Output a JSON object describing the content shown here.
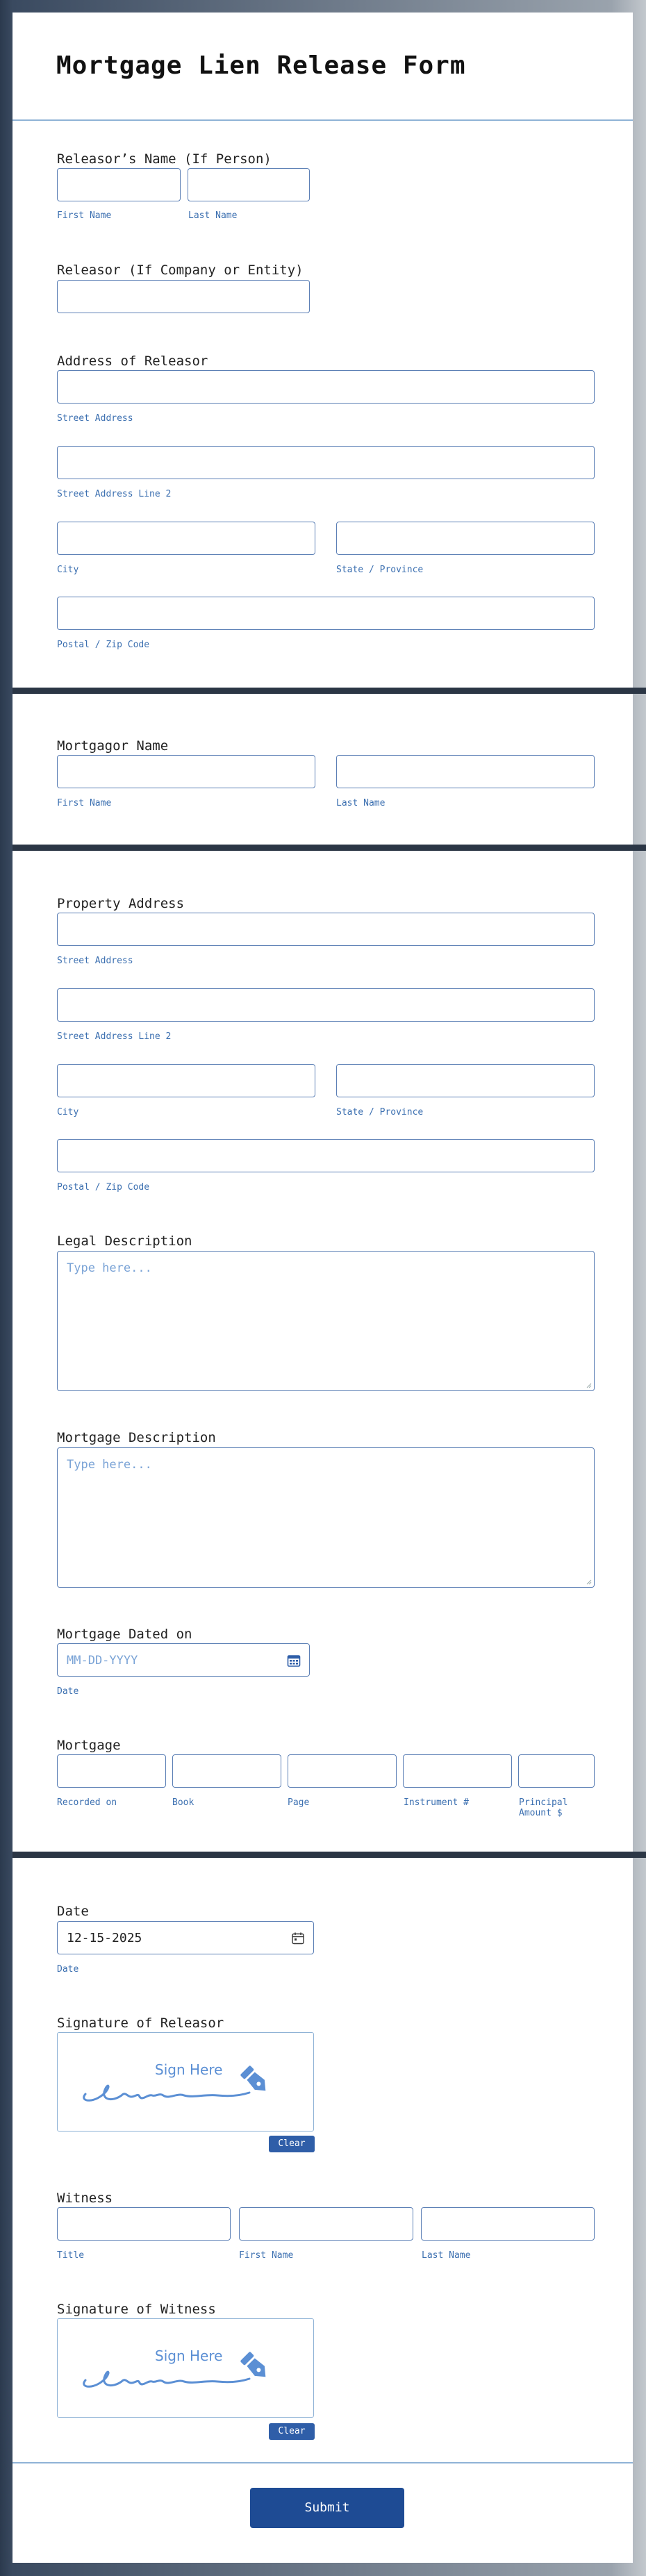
{
  "form": {
    "title": "Mortgage Lien Release Form",
    "releasor_name_label": "Releasor’s Name (If Person)",
    "first_name": "First Name",
    "last_name": "Last Name",
    "releasor_company_label": "Releasor (If Company or Entity)",
    "address_releasor_label": "Address of Releasor",
    "street_address": "Street Address",
    "street_address_2": "Street Address Line 2",
    "city": "City",
    "state": "State / Province",
    "postal": "Postal / Zip Code",
    "mortgagor_label": "Mortgagor Name",
    "property_address_label": "Property Address",
    "legal_description_label": "Legal Description",
    "mortgage_description_label": "Mortgage Description",
    "textarea_placeholder": "Type here...",
    "mortgage_dated_label": "Mortgage Dated on",
    "date_placeholder": "MM-DD-YYYY",
    "date_sub": "Date",
    "mortgage_label": "Mortgage",
    "recorded_on": "Recorded on",
    "book": "Book",
    "page": "Page",
    "instrument": "Instrument #",
    "principal_line1": "Principal",
    "principal_line2": "Amount $",
    "date_label": "Date",
    "date_value": "12-15-2025",
    "signature_releasor_label": "Signature of Releasor",
    "sign_here": "Sign Here",
    "clear": "Clear",
    "witness_label": "Witness",
    "title_sub": "Title",
    "signature_witness_label": "Signature of Witness",
    "submit": "Submit"
  },
  "colors": {
    "accent": "#2f5ea8",
    "submit": "#1e4b94",
    "field_border": "#5b7fb5",
    "sublabel": "#3b6fb0",
    "divider": "#2b3645"
  },
  "icons": [
    "calendar-icon",
    "pen-nib-icon",
    "resize-handle-icon"
  ]
}
